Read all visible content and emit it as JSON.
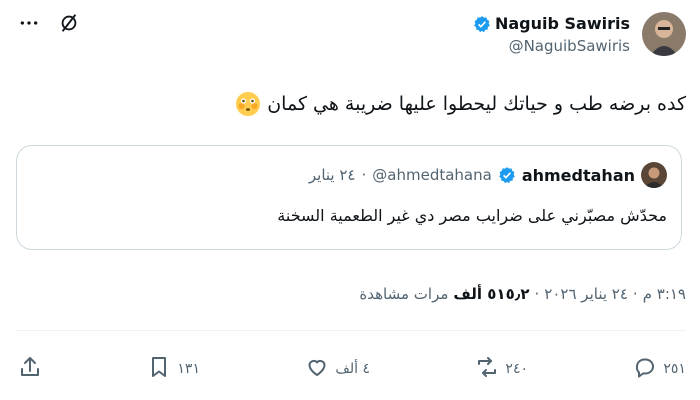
{
  "colors": {
    "verified": "#1d9bf0",
    "text": "#0f1419",
    "muted": "#536471",
    "border": "#cfd9de"
  },
  "top_icons": [
    "grok-icon",
    "more-icon"
  ],
  "author": {
    "name": "Naguib Sawiris",
    "handle": "@NaguibSawiris"
  },
  "tweet": {
    "text": "كده برضه طب و حياتك ليحطوا عليها ضريبة هي كمان",
    "emoji": "flushed-face-emoji"
  },
  "quote": {
    "name": "ahmedtahan",
    "handle": "@ahmedtahana",
    "dot": "·",
    "time": "٢٤ يناير",
    "text": "محدّش مصبّرني على ضرايب مصر دي غير الطعمية السخنة"
  },
  "meta": {
    "time": "٣:١٩ م",
    "dot1": "·",
    "date": "٢٤ يناير ٢٠٢٦",
    "dot2": "·",
    "views_count": "٥١٥٫٢ ألف",
    "views_label": "مرات مشاهدة"
  },
  "actions": {
    "replies": "٢٥١",
    "reposts": "٢٤٠",
    "likes": "٤ ألف",
    "bookmarks": "١٣١"
  }
}
